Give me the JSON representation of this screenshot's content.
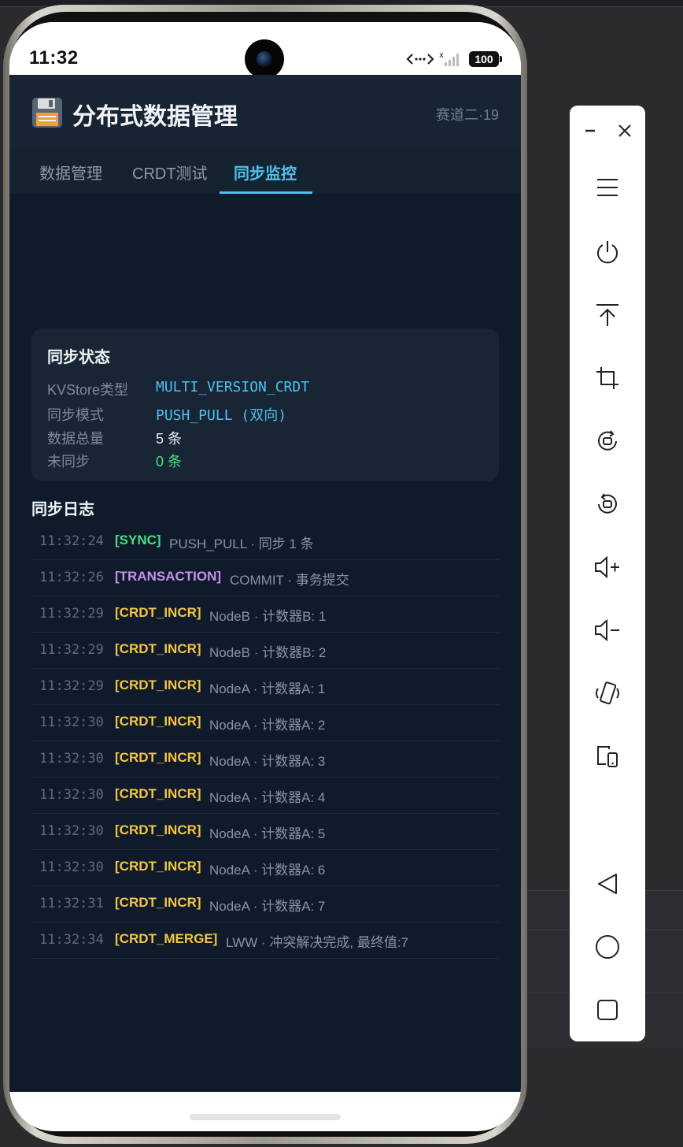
{
  "status": {
    "time": "11:32",
    "battery": "100"
  },
  "app": {
    "title": "分布式数据管理",
    "subtitle": "赛道二·19",
    "icon": "floppy-disk-icon"
  },
  "tabs": [
    {
      "label": "数据管理",
      "active": false
    },
    {
      "label": "CRDT测试",
      "active": false
    },
    {
      "label": "同步监控",
      "active": true
    }
  ],
  "sync_status": {
    "title": "同步状态",
    "rows": [
      {
        "key": "KVStore类型",
        "value": "MULTI_VERSION_CRDT",
        "color": "#4fc1f0"
      },
      {
        "key": "同步模式",
        "value": "PUSH_PULL (双向)",
        "color": "#4fc1f0"
      },
      {
        "key": "数据总量",
        "value": "5 条",
        "color": "#e8ecf0"
      },
      {
        "key": "未同步",
        "value": "0 条",
        "color": "#4ade80"
      }
    ]
  },
  "sync_log": {
    "title": "同步日志",
    "entries": [
      {
        "time": "11:32:24",
        "tag": "[SYNC]",
        "message": "PUSH_PULL · 同步 1 条"
      },
      {
        "time": "11:32:26",
        "tag": "[TRANSACTION]",
        "message": "COMMIT · 事务提交"
      },
      {
        "time": "11:32:29",
        "tag": "[CRDT_INCR]",
        "message": "NodeB · 计数器B: 1"
      },
      {
        "time": "11:32:29",
        "tag": "[CRDT_INCR]",
        "message": "NodeB · 计数器B: 2"
      },
      {
        "time": "11:32:29",
        "tag": "[CRDT_INCR]",
        "message": "NodeA · 计数器A: 1"
      },
      {
        "time": "11:32:30",
        "tag": "[CRDT_INCR]",
        "message": "NodeA · 计数器A: 2"
      },
      {
        "time": "11:32:30",
        "tag": "[CRDT_INCR]",
        "message": "NodeA · 计数器A: 3"
      },
      {
        "time": "11:32:30",
        "tag": "[CRDT_INCR]",
        "message": "NodeA · 计数器A: 4"
      },
      {
        "time": "11:32:30",
        "tag": "[CRDT_INCR]",
        "message": "NodeA · 计数器A: 5"
      },
      {
        "time": "11:32:30",
        "tag": "[CRDT_INCR]",
        "message": "NodeA · 计数器A: 6"
      },
      {
        "time": "11:32:31",
        "tag": "[CRDT_INCR]",
        "message": "NodeA · 计数器A: 7"
      },
      {
        "time": "11:32:34",
        "tag": "[CRDT_MERGE]",
        "message": "LWW · 冲突解决完成, 最终值:7"
      }
    ]
  },
  "tag_colors": {
    "[SYNC]": "#4ade80",
    "[TRANSACTION]": "#c792ea",
    "[CRDT_INCR]": "#f5c542",
    "[CRDT_MERGE]": "#f5c542"
  },
  "emulator_toolbar": [
    "minimize-icon",
    "close-icon",
    "menu-icon",
    "power-icon",
    "pin-top-icon",
    "crop-icon",
    "rotate-icon",
    "rotate-alt-icon",
    "volume-up-icon",
    "volume-down-icon",
    "shake-icon",
    "multi-device-icon",
    "back-icon",
    "home-icon",
    "recents-icon"
  ]
}
